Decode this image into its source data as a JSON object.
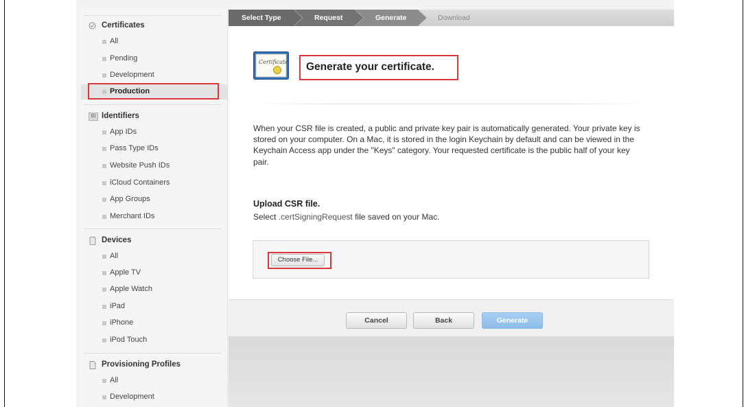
{
  "sidebar": {
    "certificates": {
      "label": "Certificates",
      "items": [
        "All",
        "Pending",
        "Development",
        "Production"
      ]
    },
    "identifiers": {
      "icon_text": "ID",
      "label": "Identifiers",
      "items": [
        "App IDs",
        "Pass Type IDs",
        "Website Push IDs",
        "iCloud Containers",
        "App Groups",
        "Merchant IDs"
      ]
    },
    "devices": {
      "label": "Devices",
      "items": [
        "All",
        "Apple TV",
        "Apple Watch",
        "iPad",
        "iPhone",
        "iPod Touch"
      ]
    },
    "profiles": {
      "label": "Provisioning Profiles",
      "items": [
        "All",
        "Development"
      ]
    }
  },
  "wizard": {
    "steps": [
      "Select Type",
      "Request",
      "Generate",
      "Download"
    ]
  },
  "main": {
    "cert_icon_text": "Certificate",
    "title": "Generate your certificate.",
    "description": "When your CSR file is created, a public and private key pair is automatically generated. Your private key is stored on your computer. On a Mac, it is stored in the login Keychain by default and can be viewed in the Keychain Access app under the \"Keys\" category. Your requested certificate is the public half of your key pair.",
    "upload_title": "Upload CSR file.",
    "upload_sub_prefix": "Select ",
    "upload_sub_ext": ".certSigningRequest",
    "upload_sub_suffix": " file saved on your Mac.",
    "choose_file": "Choose File..."
  },
  "buttons": {
    "cancel": "Cancel",
    "back": "Back",
    "generate": "Generate"
  },
  "colors": {
    "highlight": "#d9363e",
    "step_done": "#6e6e6e",
    "step_current": "#8c8c8c",
    "generate_button": "#9ec8ef"
  }
}
